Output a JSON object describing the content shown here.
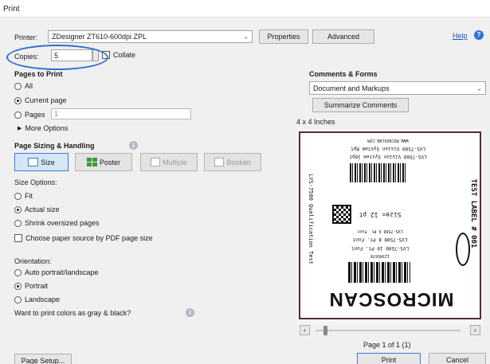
{
  "window": {
    "title": "Print"
  },
  "top": {
    "printer_label": "Printer:",
    "printer_value": "ZDesigner ZT610-600dpi ZPL",
    "properties_label": "Properties",
    "advanced_label": "Advanced",
    "help_label": "Help",
    "copies_label": "Copies:",
    "copies_value": "5",
    "collate_label": "Collate"
  },
  "pages": {
    "heading": "Pages to Print",
    "all_label": "All",
    "current_label": "Current page",
    "pages_label": "Pages",
    "pages_value": "1",
    "more_label": "More Options"
  },
  "sizing": {
    "heading": "Page Sizing & Handling",
    "buttons": [
      "Size",
      "Poster",
      "Multiple",
      "Booklet"
    ],
    "size_options_label": "Size Options:",
    "fit_label": "Fit",
    "actual_label": "Actual size",
    "shrink_label": "Shrink oversized pages",
    "paper_source_label": "Choose paper source by PDF page size"
  },
  "orientation": {
    "heading": "Orientation:",
    "auto_label": "Auto portrait/landscape",
    "portrait_label": "Portrait",
    "landscape_label": "Landscape",
    "gray_label": "Want to print colors as gray & black?"
  },
  "comments": {
    "heading": "Comments & Forms",
    "select_value": "Document and Markups",
    "summarize_label": "Summarize Comments",
    "size_text": "4 x 4 Inches"
  },
  "preview": {
    "page_text": "Page 1 of 1 (1)",
    "label_logo": "MICROSCAN",
    "label_side_left": "LVS-7500 Qualification Test",
    "label_side_right": "TEST LABEL # 001",
    "label_lines": [
      "LVS-7500 Vision System Rpt",
      "LVS-7500 Vision System 10pt",
      "LVS-7500 10 Pt. Font",
      "LVS-7500 8 Pt. Font",
      "LVS-7500 6 Pt. Font",
      "Size= 12 pt",
      "WWW.MICROSCAN.COM",
      "12345678"
    ]
  },
  "bottom": {
    "page_setup_label": "Page Setup...",
    "print_label": "Print",
    "cancel_label": "Cancel"
  },
  "colors": {
    "annotation_circle": "#2f6fd0",
    "link": "#1a54b8"
  }
}
